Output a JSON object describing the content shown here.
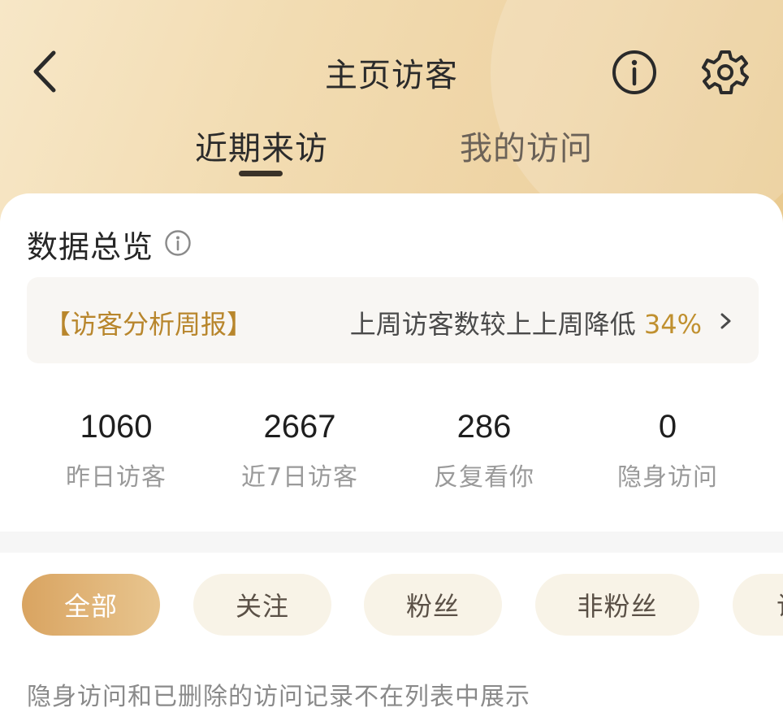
{
  "header": {
    "title": "主页访客"
  },
  "icons": {
    "back": "back-chevron-icon",
    "info": "info-circle-icon",
    "settings": "gear-icon"
  },
  "tabs": [
    {
      "label": "近期来访",
      "active": true
    },
    {
      "label": "我的访问",
      "active": false
    }
  ],
  "overview": {
    "title": "数据总览",
    "report": {
      "tag": "【访客分析周报】",
      "text": "上周访客数较上上周降低 ",
      "percent": "34%"
    },
    "stats": [
      {
        "value": "1060",
        "label": "昨日访客"
      },
      {
        "value": "2667",
        "label": "近7日访客"
      },
      {
        "value": "286",
        "label": "反复看你"
      },
      {
        "value": "0",
        "label": "隐身访问"
      }
    ]
  },
  "filters": [
    {
      "label": "全部",
      "active": true
    },
    {
      "label": "关注",
      "active": false
    },
    {
      "label": "粉丝",
      "active": false
    },
    {
      "label": "非粉丝",
      "active": false
    },
    {
      "label": "访",
      "active": false
    }
  ],
  "note": "隐身访问和已删除的访问记录不在列表中展示",
  "colors": {
    "accent": "#c0902f",
    "chip_active_start": "#d9a461",
    "chip_active_end": "#e8c58f",
    "chip_bg": "#f8f3e7"
  }
}
